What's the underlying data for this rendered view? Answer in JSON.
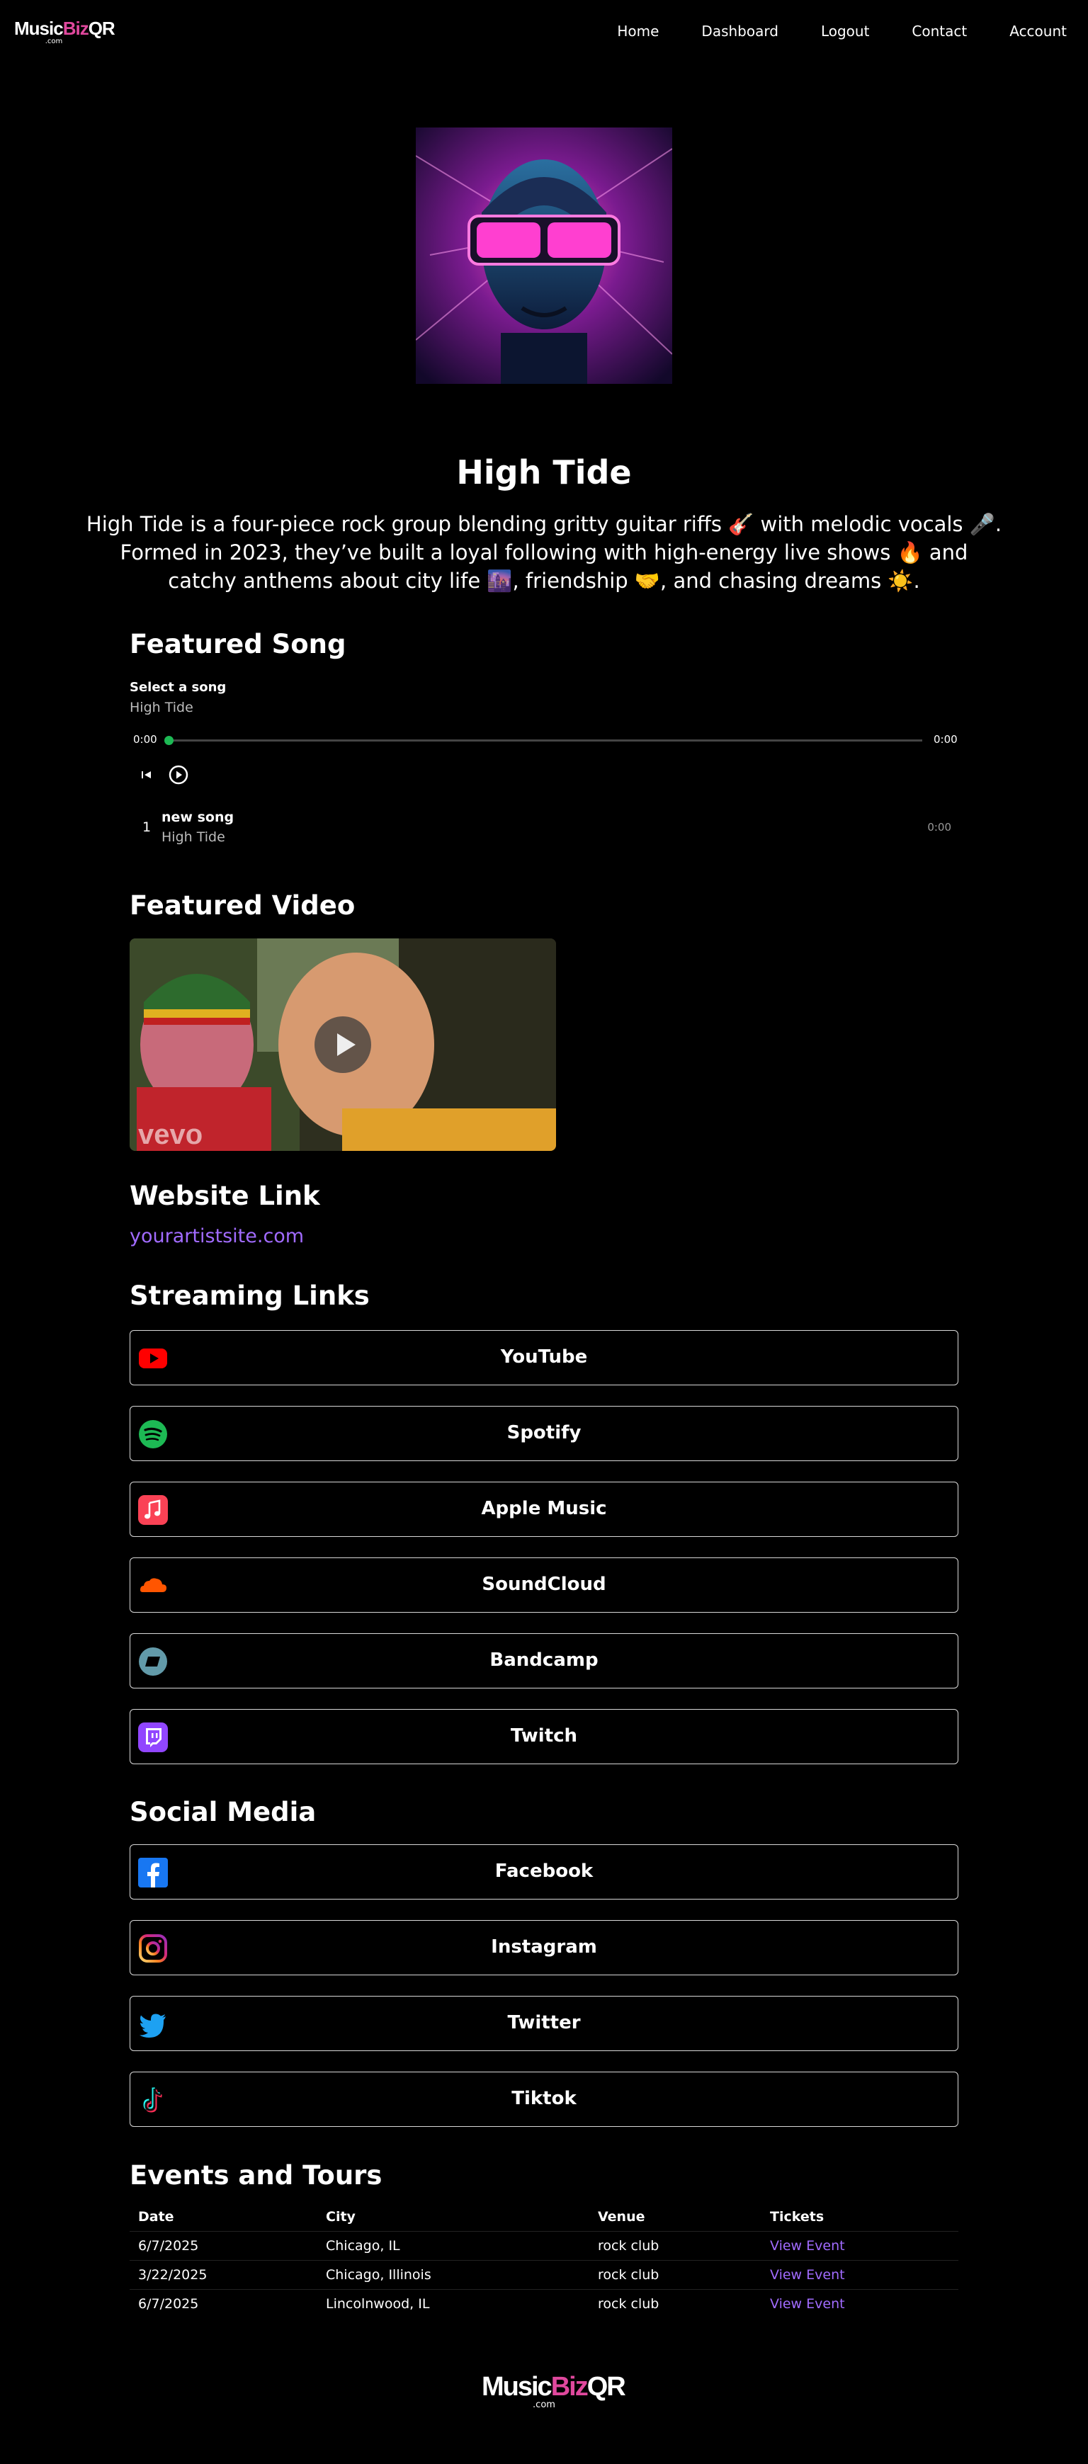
{
  "brand": {
    "logo_part1": "Music",
    "logo_part2": "Biz",
    "logo_part3": "QR",
    "logo_suffix": ".com",
    "accent_pink": "#e0489d"
  },
  "nav": {
    "items": [
      "Home",
      "Dashboard",
      "Logout",
      "Contact",
      "Account"
    ]
  },
  "artist": {
    "name": "High Tide",
    "bio": "High Tide is a four-piece rock group blending gritty guitar riffs 🎸 with melodic vocals 🎤. Formed in 2023, they’ve built a loyal following with high-energy live shows 🔥 and catchy anthems about city life 🌆, friendship 🤝, and chasing dreams ☀️."
  },
  "featured_song": {
    "title": "Featured Song",
    "select_label": "Select a song",
    "select_artist": "High Tide",
    "time_current": "0:00",
    "time_total": "0:00",
    "progress": 0,
    "tracks": [
      {
        "num": "1",
        "title": "new song",
        "artist": "High Tide",
        "duration": "0:00"
      }
    ]
  },
  "featured_video": {
    "title": "Featured Video",
    "watermark": "vevo"
  },
  "website": {
    "title": "Website Link",
    "link_text": "yourartistsite.com"
  },
  "streaming": {
    "title": "Streaming Links",
    "links": [
      {
        "label": "YouTube",
        "icon": "youtube-icon",
        "color": "#ff0000"
      },
      {
        "label": "Spotify",
        "icon": "spotify-icon",
        "color": "#1db954"
      },
      {
        "label": "Apple Music",
        "icon": "apple-music-icon",
        "color": "#fa4255"
      },
      {
        "label": "SoundCloud",
        "icon": "soundcloud-icon",
        "color": "#ff5500"
      },
      {
        "label": "Bandcamp",
        "icon": "bandcamp-icon",
        "color": "#629aa9"
      },
      {
        "label": "Twitch",
        "icon": "twitch-icon",
        "color": "#9146ff"
      }
    ]
  },
  "social": {
    "title": "Social Media",
    "links": [
      {
        "label": "Facebook",
        "icon": "facebook-icon",
        "color": "#1877f2"
      },
      {
        "label": "Instagram",
        "icon": "instagram-icon",
        "color": "#e1306c"
      },
      {
        "label": "Twitter",
        "icon": "twitter-icon",
        "color": "#1da1f2"
      },
      {
        "label": "Tiktok",
        "icon": "tiktok-icon",
        "color": "#fe2c55"
      }
    ]
  },
  "events": {
    "title": "Events and Tours",
    "columns": [
      "Date",
      "City",
      "Venue",
      "Tickets"
    ],
    "rows": [
      {
        "date": "6/7/2025",
        "city": "Chicago, IL",
        "venue": "rock club",
        "tickets": "View Event"
      },
      {
        "date": "3/22/2025",
        "city": "Chicago, Illinois",
        "venue": "rock club",
        "tickets": "View Event"
      },
      {
        "date": "6/7/2025",
        "city": "Lincolnwood, IL",
        "venue": "rock club",
        "tickets": "View Event"
      }
    ]
  }
}
